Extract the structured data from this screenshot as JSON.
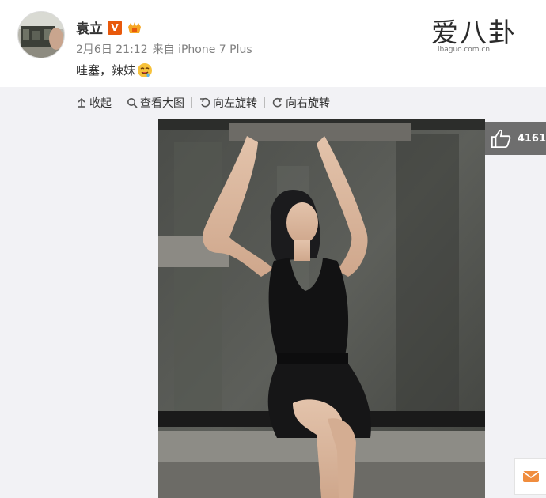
{
  "post": {
    "username": "袁立",
    "verified_badge": "V",
    "date": "2月6日 21:12",
    "source": "来自 iPhone 7 Plus",
    "text": "哇塞，辣妹",
    "avatar_icon": "avatar-photo",
    "member_icon": "vip-member-icon",
    "emoji_icon": "drooling-face-emoji"
  },
  "watermark": {
    "title": "爱八卦",
    "url": "ibaguo.com.cn"
  },
  "toolbar": {
    "collapse_label": "收起",
    "view_large_label": "查看大图",
    "rotate_left_label": "向左旋转",
    "rotate_right_label": "向右旋转"
  },
  "likes": {
    "count": "4161",
    "icon": "thumbs-up-icon"
  },
  "colors": {
    "accent_orange": "#e8590c",
    "media_bg": "#f2f2f5",
    "like_bg": "#6e6e6e"
  }
}
